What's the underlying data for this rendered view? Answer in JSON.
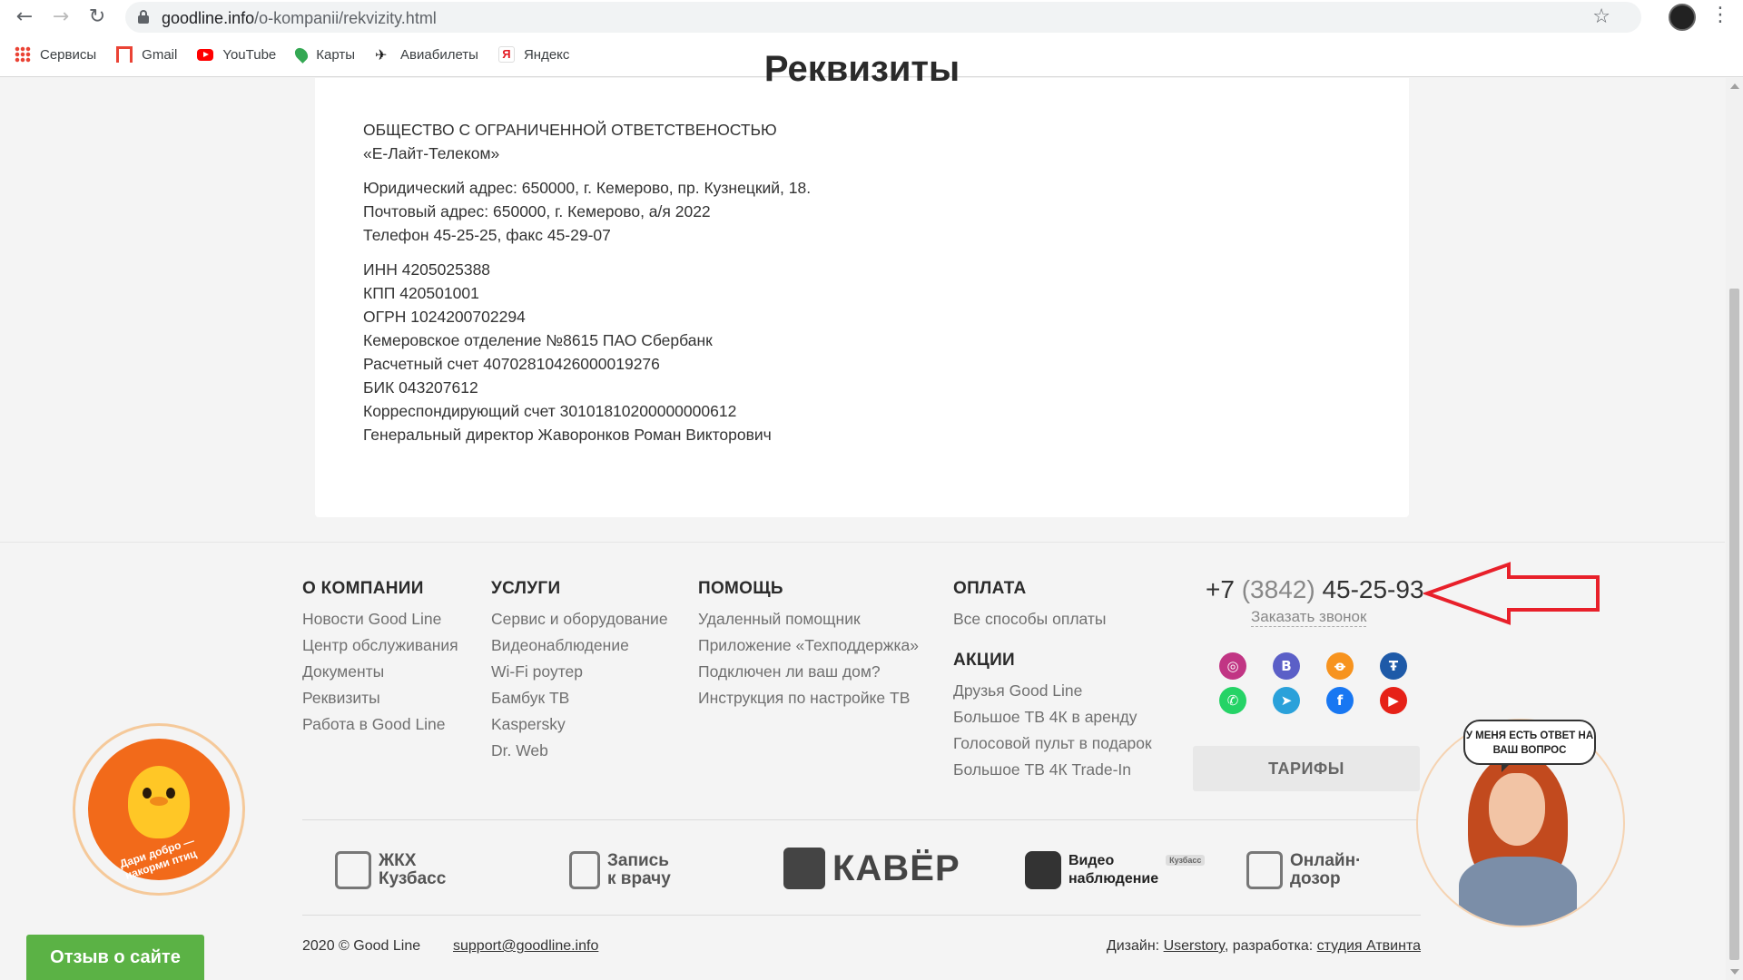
{
  "browser": {
    "url_domain": "goodline.info",
    "url_path": "/o-kompanii/rekvizity.html",
    "bookmarks": [
      {
        "label": "Сервисы",
        "icon": "apps-grid-icon"
      },
      {
        "label": "Gmail",
        "icon": "gmail-icon"
      },
      {
        "label": "YouTube",
        "icon": "youtube-icon"
      },
      {
        "label": "Карты",
        "icon": "maps-pin-icon"
      },
      {
        "label": "Авиабилеты",
        "icon": "airplane-icon"
      },
      {
        "label": "Яндекс",
        "icon": "yandex-icon"
      }
    ]
  },
  "page": {
    "heading": "Реквизиты",
    "company_line1": "ОБЩЕСТВО С ОГРАНИЧЕННОЙ ОТВЕТСТВЕНОСТЬЮ",
    "company_line2": "«Е-Лайт-Телеком»",
    "legal_address": "Юридический адрес: 650000, г. Кемерово, пр. Кузнецкий, 18.",
    "postal_address": "Почтовый адрес: 650000, г. Кемерово, а/я 2022",
    "phone_fax": "Телефон 45-25-25, факс 45-29-07",
    "inn": "ИНН 4205025388",
    "kpp": "КПП 420501001",
    "ogrn": "ОГРН 1024200702294",
    "bank": "Кемеровское отделение №8615 ПАО Сбербанк",
    "account": "Расчетный счет 40702810426000019276",
    "bik": "БИК 043207612",
    "corr_account": "Корреспондирующий счет 30101810200000000612",
    "director": "Генеральный директор Жаворонков Роман Викторович"
  },
  "footer": {
    "about": {
      "title": "О КОМПАНИИ",
      "links": [
        "Новости Good Line",
        "Центр обслуживания",
        "Документы",
        "Реквизиты",
        "Работа в Good Line"
      ]
    },
    "services": {
      "title": "УСЛУГИ",
      "links": [
        "Сервис и оборудование",
        "Видеонаблюдение",
        "Wi-Fi роутер",
        "Бамбук ТВ",
        "Kaspersky",
        "Dr. Web"
      ]
    },
    "help": {
      "title": "ПОМОЩЬ",
      "links": [
        "Удаленный помощник",
        "Приложение «Техподдержка»",
        "Подключен ли ваш дом?",
        "Инструкция по настройке ТВ"
      ]
    },
    "payment": {
      "title": "ОПЛАТА",
      "links": [
        "Все способы оплаты"
      ]
    },
    "promos": {
      "title": "АКЦИИ",
      "links": [
        "Друзья Good Line",
        "Большое ТВ 4К в аренду",
        "Голосовой пульт в подарок",
        "Большое ТВ 4К Trade-In"
      ]
    },
    "phone_prefix": "+7",
    "phone_code": "(3842)",
    "phone_number": "45-25-93",
    "callback": "Заказать звонок",
    "socials": [
      {
        "icon": "instagram-icon",
        "color": "#c13584",
        "glyph": "◎"
      },
      {
        "icon": "vk-icon",
        "color": "#5b5fc7",
        "glyph": "B"
      },
      {
        "icon": "odnoklassniki-icon",
        "color": "#f7931e",
        "glyph": "ꝋ"
      },
      {
        "icon": "livejournal-icon",
        "color": "#1e5aa8",
        "glyph": "Ŧ"
      },
      {
        "icon": "whatsapp-icon",
        "color": "#25d366",
        "glyph": "✆"
      },
      {
        "icon": "telegram-icon",
        "color": "#2aa1da",
        "glyph": "➤"
      },
      {
        "icon": "facebook-icon",
        "color": "#1877f2",
        "glyph": "f"
      },
      {
        "icon": "youtube-icon",
        "color": "#e62117",
        "glyph": "▶"
      }
    ],
    "tariffs_button": "ТАРИФЫ",
    "partners": {
      "zhkh": "ЖКХ\nКузбасс",
      "doctor": "Запись\nк врачу",
      "kaver": "КАВЁР",
      "video": "Видео\nнаблюдение",
      "video_tag": "Кузбасс",
      "dozor": "Онлайн·\nдозор"
    },
    "copyright": "2020 © Good Line",
    "support_email": "support@goodline.info",
    "design_label": "Дизайн:",
    "design_studio": "Userstory",
    "dev_label": ", разработка:",
    "dev_studio": "студия Атвинта"
  },
  "widgets": {
    "chick_slogan": "Дари добро — накорми птиц",
    "review_button": "Отзыв о сайте",
    "assistant_bubble": "У МЕНЯ ЕСТЬ ОТВЕТ НА ВАШ ВОПРОС"
  }
}
